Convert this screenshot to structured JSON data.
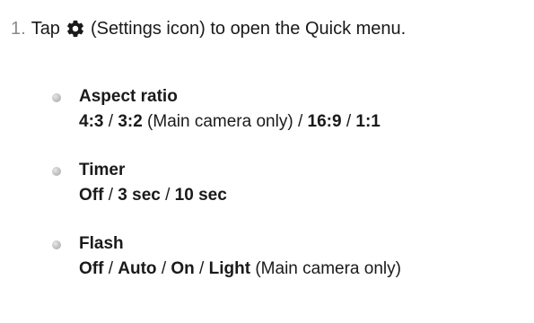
{
  "step": {
    "number": "1.",
    "before_icon": "Tap",
    "icon": "settings-gear-icon",
    "after_icon": "(Settings icon) to open the Quick menu."
  },
  "options": [
    {
      "title": "Aspect ratio",
      "segments": [
        {
          "text": "4:3",
          "bold": true
        },
        {
          "text": " / ",
          "bold": false
        },
        {
          "text": "3:2",
          "bold": true
        },
        {
          "text": " (Main camera only) / ",
          "bold": false
        },
        {
          "text": "16:9",
          "bold": true
        },
        {
          "text": " / ",
          "bold": false
        },
        {
          "text": "1:1",
          "bold": true
        }
      ]
    },
    {
      "title": "Timer",
      "segments": [
        {
          "text": "Off",
          "bold": true
        },
        {
          "text": " / ",
          "bold": false
        },
        {
          "text": "3 sec",
          "bold": true
        },
        {
          "text": " / ",
          "bold": false
        },
        {
          "text": "10 sec",
          "bold": true
        }
      ]
    },
    {
      "title": "Flash",
      "segments": [
        {
          "text": "Off",
          "bold": true
        },
        {
          "text": " / ",
          "bold": false
        },
        {
          "text": "Auto",
          "bold": true
        },
        {
          "text": " / ",
          "bold": false
        },
        {
          "text": "On",
          "bold": true
        },
        {
          "text": " / ",
          "bold": false
        },
        {
          "text": "Light",
          "bold": true
        },
        {
          "text": " (Main camera only)",
          "bold": false
        }
      ]
    }
  ],
  "colors": {
    "text": "#1a1a1a",
    "step_number": "#8a8a8a",
    "bullet": "#bdbdbd"
  }
}
